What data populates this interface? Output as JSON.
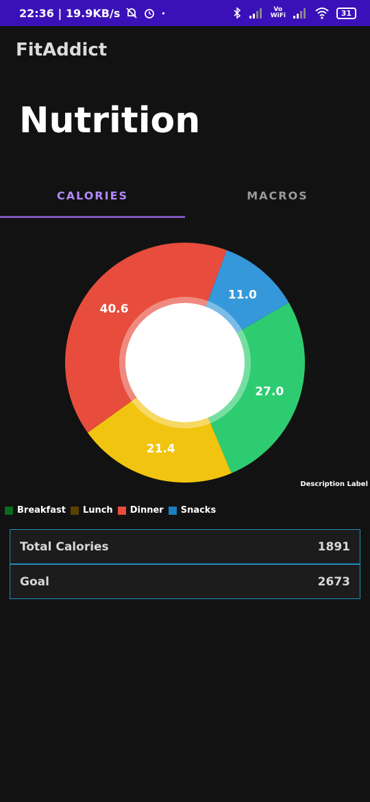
{
  "status_bar": {
    "time_speed": "22:36 | 19.9KB/s",
    "network_label": "Vo WiFi",
    "battery": "31"
  },
  "app": {
    "title": "FitAddict"
  },
  "page": {
    "title": "Nutrition"
  },
  "tabs": [
    {
      "label": "CALORIES",
      "active": true
    },
    {
      "label": "MACROS",
      "active": false
    }
  ],
  "chart_data": {
    "type": "pie",
    "hole": true,
    "slices": [
      {
        "label": "Breakfast",
        "value": 27.0,
        "color": "#2ecc71"
      },
      {
        "label": "Lunch",
        "value": 21.4,
        "color": "#f1c40f"
      },
      {
        "label": "Dinner",
        "value": 40.6,
        "color": "#e74c3c"
      },
      {
        "label": "Snacks",
        "value": 11.0,
        "color": "#3498db"
      }
    ],
    "description_label": "Description Label",
    "legend": [
      {
        "label": "Breakfast",
        "color": "#0a6b1e"
      },
      {
        "label": "Lunch",
        "color": "#5a4200"
      },
      {
        "label": "Dinner",
        "color": "#e74c3c"
      },
      {
        "label": "Snacks",
        "color": "#1a7fc1"
      }
    ]
  },
  "summary": {
    "total_label": "Total Calories",
    "total_value": "1891",
    "goal_label": "Goal",
    "goal_value": "2673"
  }
}
